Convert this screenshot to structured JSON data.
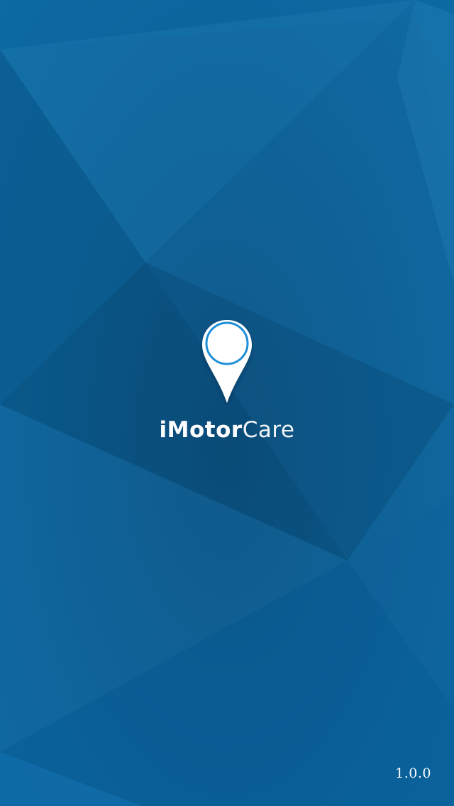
{
  "splash": {
    "app_name_bold": "iMotor",
    "app_name_light": "Care",
    "version": "1.0.0",
    "logo_icon": "location-pin-icon"
  },
  "colors": {
    "background": "#0a5a8c",
    "accent_ring": "#1e8fd8",
    "text": "#ffffff"
  }
}
